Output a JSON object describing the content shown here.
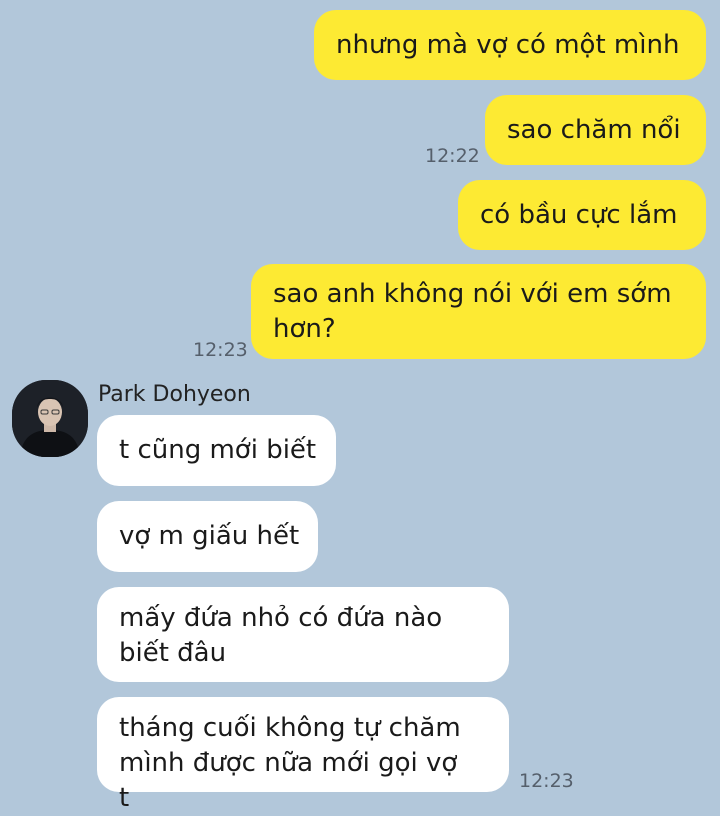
{
  "outgoing": [
    {
      "text": "nhưng mà vợ có một mình"
    },
    {
      "text": "sao chăm nổi",
      "time": "12:22"
    },
    {
      "text": "có bầu cực lắm"
    },
    {
      "text": "sao anh không nói với em sớm hơn?",
      "time": "12:23"
    }
  ],
  "incoming": {
    "sender": "Park Dohyeon",
    "messages": [
      {
        "text": "t cũng mới biết"
      },
      {
        "text": "vợ m giấu hết"
      },
      {
        "text": "mấy đứa nhỏ có đứa nào biết đâu"
      },
      {
        "text": "tháng cuối không tự chăm mình được nữa mới gọi vợ t",
        "time": "12:23"
      }
    ]
  },
  "colors": {
    "background": "#b2c7da",
    "outgoing_bubble": "#fdea33",
    "incoming_bubble": "#ffffff",
    "timestamp": "#555f6b"
  },
  "icons": {
    "avatar": "user-avatar-photo"
  }
}
